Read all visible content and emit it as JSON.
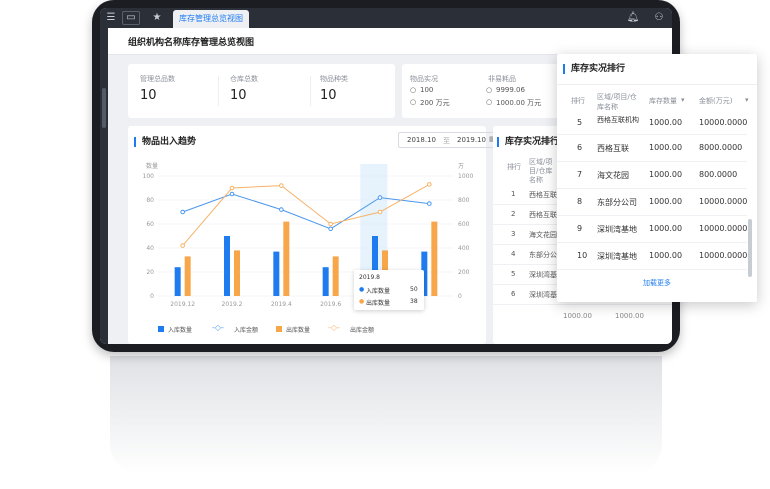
{
  "tabs": {
    "active": "库存管理总览视图"
  },
  "page": {
    "title": "组织机构名称库存管理总览视图"
  },
  "stats": {
    "items": [
      {
        "label": "管理总品数",
        "value": "10"
      },
      {
        "label": "仓库总数",
        "value": "10"
      },
      {
        "label": "物品种类",
        "value": "10"
      }
    ],
    "qty_label": "物品实况",
    "qty_rows": [
      "100",
      "200 万元"
    ],
    "special_label": "非易耗品",
    "special_rows": [
      "9999.06",
      "1000.00 万元"
    ]
  },
  "trend": {
    "title": "物品出入趋势",
    "date_from": "2018.10",
    "date_sep": "至",
    "date_to": "2019.10",
    "left_unit": "数量",
    "right_unit": "万",
    "legend": [
      "入库数量",
      "入库金额",
      "出库数量",
      "出库金额"
    ]
  },
  "chart_data": {
    "type": "bar",
    "categories": [
      "2019.12",
      "2019.2",
      "2019.4",
      "2019.6",
      "2019.8",
      ""
    ],
    "ylim_left": [
      0,
      100
    ],
    "ylim_right": [
      0,
      1000
    ],
    "left_ticks": [
      "0",
      "20",
      "40",
      "60",
      "80",
      "100"
    ],
    "right_ticks": [
      "0",
      "200",
      "400",
      "600",
      "800",
      "1000"
    ],
    "series": [
      {
        "name": "入库数量",
        "kind": "bar",
        "color": "#1f7cf0",
        "values": [
          24,
          50,
          37,
          24,
          50,
          37
        ]
      },
      {
        "name": "出库数量",
        "kind": "bar",
        "color": "#f7a64a",
        "values": [
          33,
          38,
          62,
          33,
          38,
          62
        ]
      },
      {
        "name": "入库金额",
        "kind": "line",
        "color": "#4a97ee",
        "values": [
          700,
          850,
          720,
          560,
          820,
          770
        ]
      },
      {
        "name": "出库金额",
        "kind": "line",
        "color": "#f7b266",
        "values": [
          420,
          900,
          920,
          600,
          700,
          930
        ]
      }
    ]
  },
  "tooltip": {
    "title": "2019.8",
    "rows": [
      {
        "label": "入库数量",
        "value": "50"
      },
      {
        "label": "出库数量",
        "value": "38"
      }
    ]
  },
  "rank_mini": {
    "title": "库存实况排行",
    "header": [
      "排行",
      "区域/项目/仓库名称"
    ],
    "rows": [
      {
        "rank": "1",
        "name": "西格互联同"
      },
      {
        "rank": "2",
        "name": "西格互联"
      },
      {
        "rank": "3",
        "name": "海文花园"
      },
      {
        "rank": "4",
        "name": "东部分公司"
      },
      {
        "rank": "5",
        "name": "深圳湾基地"
      },
      {
        "rank": "6",
        "name": "深圳湾基地"
      }
    ],
    "extra": [
      "1000.00",
      "1000.00"
    ]
  },
  "rank_popup": {
    "title": "库存实况排行",
    "col_rank": "排行",
    "col_name": "区域/项目/仓库名称",
    "col_qty": "库存数量",
    "col_amount": "金额(万元)",
    "partial_row": {
      "rank": "5",
      "name": "西格互联机构",
      "qty": "1000.00",
      "amount": "10000.0000"
    },
    "rows": [
      {
        "rank": "6",
        "name": "西格互联",
        "qty": "1000.00",
        "amount": "8000.0000"
      },
      {
        "rank": "7",
        "name": "海文花园",
        "qty": "1000.00",
        "amount": "800.0000"
      },
      {
        "rank": "8",
        "name": "东部分公司",
        "qty": "1000.00",
        "amount": "10000.0000"
      },
      {
        "rank": "9",
        "name": "深圳湾基地",
        "qty": "1000.00",
        "amount": "10000.0000"
      },
      {
        "rank": "10",
        "name": "深圳湾基地",
        "qty": "1000.00",
        "amount": "10000.0000"
      }
    ],
    "load_more": "加载更多"
  }
}
